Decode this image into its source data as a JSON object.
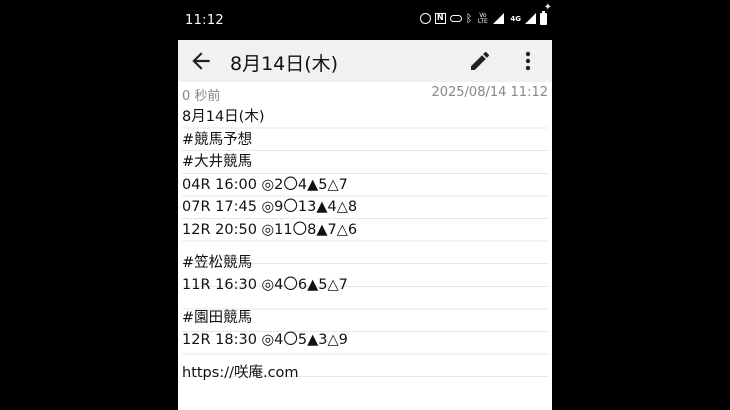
{
  "status_bar": {
    "time": "11:12",
    "icons": [
      "alarm-icon",
      "nfc-icon",
      "key-icon",
      "bluetooth-icon",
      "volte-icon",
      "signal-icon",
      "4g-signal-icon",
      "battery-icon"
    ],
    "network_label": "4G",
    "volte_label": "Vo LTE"
  },
  "toolbar": {
    "title": "8月14日(木)"
  },
  "meta": {
    "updated_ago": "0 秒前",
    "timestamp": "2025/08/14 11:12"
  },
  "note": {
    "header": [
      "8月14日(木)",
      "#競馬予想",
      "#大井競馬"
    ],
    "oi_races": [
      "04R 16:00 ◎2〇4▲5△7",
      "07R 17:45 ◎9〇13▲4△8",
      "12R 20:50 ◎11〇8▲7△6"
    ],
    "kasamatsu_title": "#笠松競馬",
    "kasamatsu_races": [
      "11R 16:30 ◎4〇6▲5△7"
    ],
    "sonoda_title": "#園田競馬",
    "sonoda_races": [
      "12R 18:30 ◎4〇5▲3△9"
    ],
    "link": "https://咲庵.com"
  },
  "colors": {
    "toolbar_bg": "#f1f1f1",
    "page_bg": "#ffffff",
    "text": "#111111",
    "meta_text": "#888888"
  }
}
